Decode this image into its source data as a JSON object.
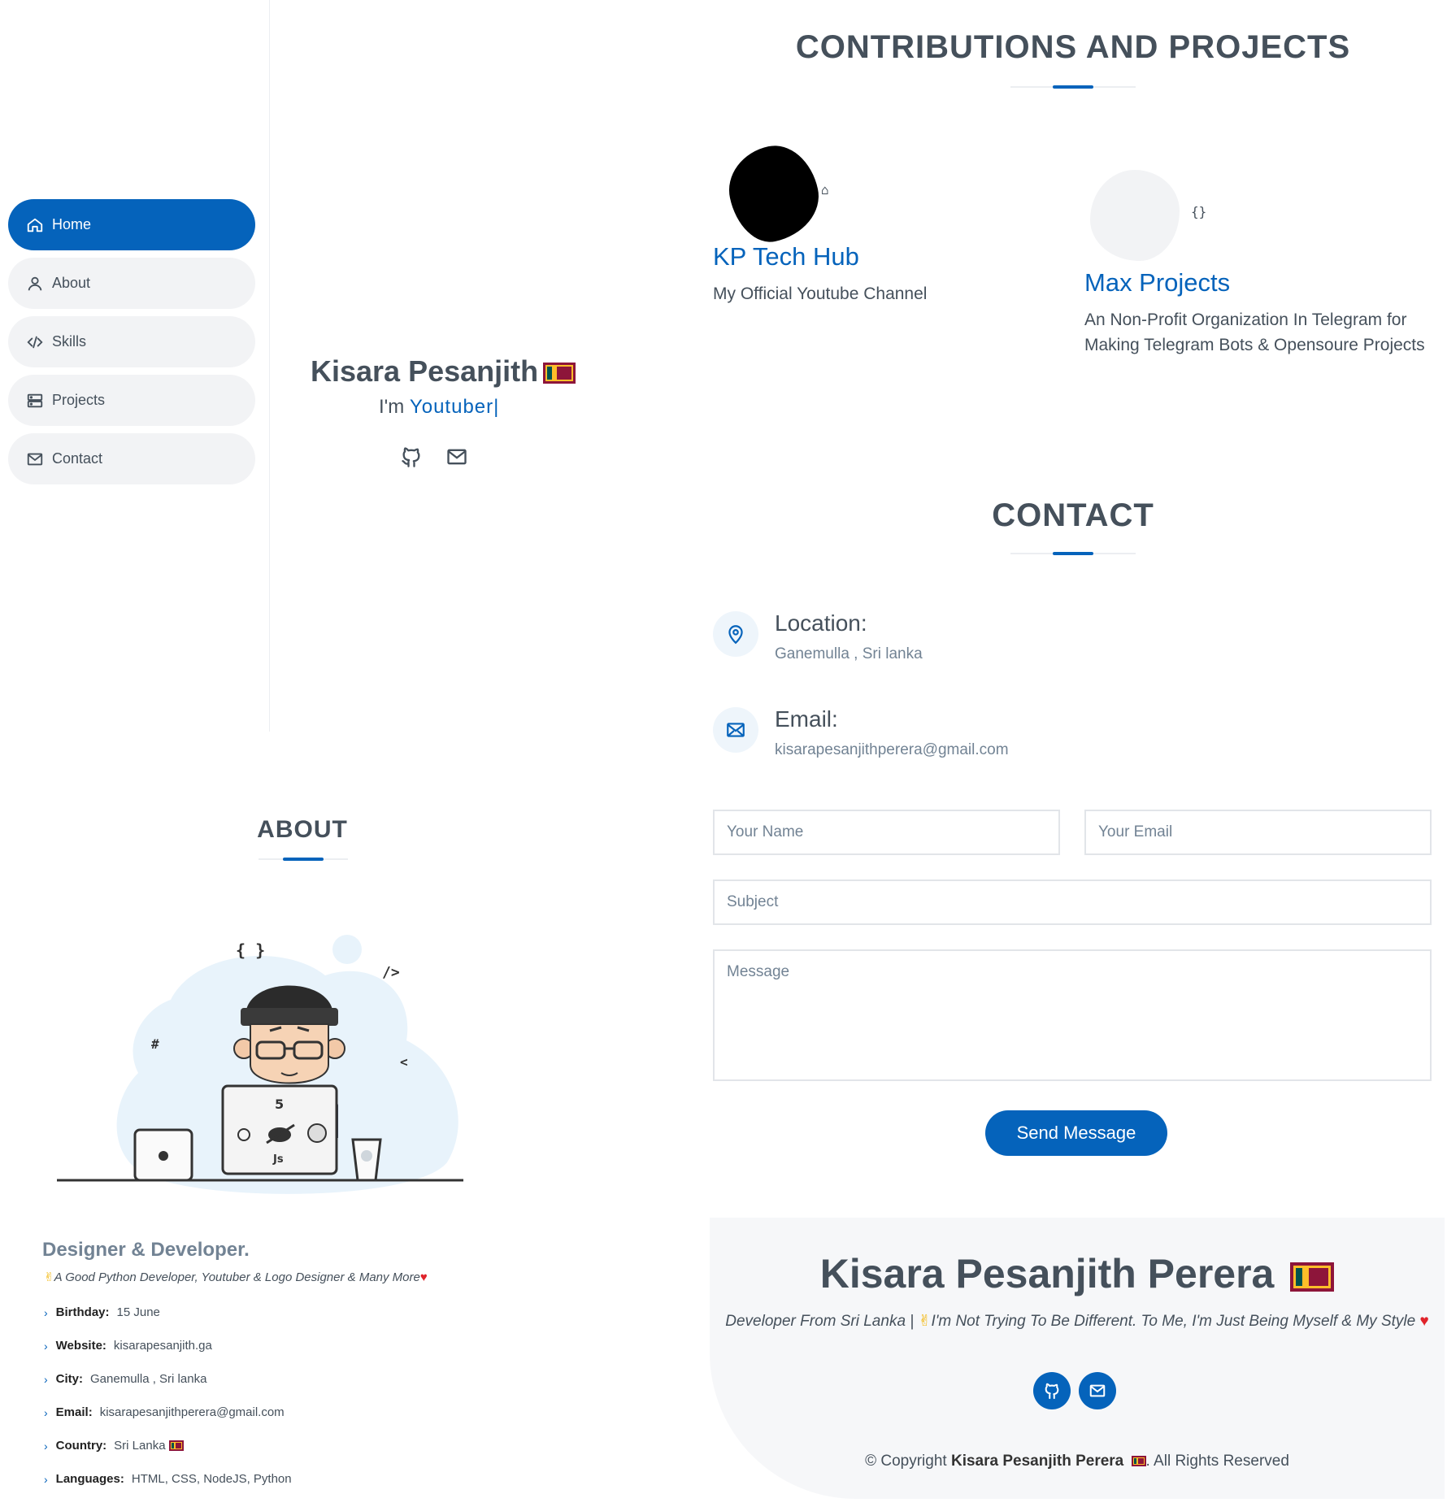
{
  "sidebar": {
    "items": [
      {
        "label": "Home",
        "icon": "home-icon",
        "active": true
      },
      {
        "label": "About",
        "icon": "person-icon",
        "active": false
      },
      {
        "label": "Skills",
        "icon": "code-icon",
        "active": false
      },
      {
        "label": "Projects",
        "icon": "server-icon",
        "active": false
      },
      {
        "label": "Contact",
        "icon": "envelope-icon",
        "active": false
      }
    ]
  },
  "hero": {
    "name": "Kisara Pesanjith",
    "prefix": "I'm",
    "typed": "Youtuber|",
    "social": [
      "github-icon",
      "envelope-icon"
    ]
  },
  "projects": {
    "title": "CONTRIBUTIONS AND PROJECTS",
    "items": [
      {
        "title": "KP Tech Hub",
        "desc": "My Official Youtube Channel",
        "icon": "robot-icon"
      },
      {
        "title": "Max Projects",
        "desc": "An Non-Profit Organization In Telegram for Making Telegram Bots & Opensoure Projects",
        "icon": "braces-icon"
      }
    ]
  },
  "contact": {
    "title": "CONTACT",
    "location_label": "Location:",
    "location_value": "Ganemulla , Sri lanka",
    "email_label": "Email:",
    "email_value": "kisarapesanjithperera@gmail.com",
    "form": {
      "name_placeholder": "Your Name",
      "email_placeholder": "Your Email",
      "subject_placeholder": "Subject",
      "message_placeholder": "Message",
      "send_label": "Send Message"
    }
  },
  "footer": {
    "name": "Kisara Pesanjith Perera",
    "tagline_pre": "Developer From Sri Lanka |",
    "tagline_post": "I'm Not Trying To Be Different. To Me, I'm Just Being Myself & My Style",
    "copy_pre": "© Copyright",
    "copy_name": "Kisara Pesanjith Perera",
    "copy_post": ". All Rights Reserved"
  },
  "about": {
    "title": "ABOUT",
    "heading": "Designer & Developer.",
    "tagline": "A Good Python Developer, Youtuber & Logo Designer & Many More",
    "details": [
      {
        "key": "Birthday:",
        "value": "15 June"
      },
      {
        "key": "Website:",
        "value": "kisarapesanjith.ga"
      },
      {
        "key": "City:",
        "value": "Ganemulla , Sri lanka"
      },
      {
        "key": "Email:",
        "value": "kisarapesanjithperera@gmail.com"
      },
      {
        "key": "Country:",
        "value": "Sri Lanka"
      },
      {
        "key": "Languages:",
        "value": "HTML, CSS, NodeJS, Python"
      }
    ],
    "illustration_glyphs": [
      "{ }",
      "/>",
      "#",
      "<",
      "5",
      "Js"
    ]
  },
  "colors": {
    "accent": "#0563bb",
    "text": "#45505b",
    "muted": "#728394"
  }
}
